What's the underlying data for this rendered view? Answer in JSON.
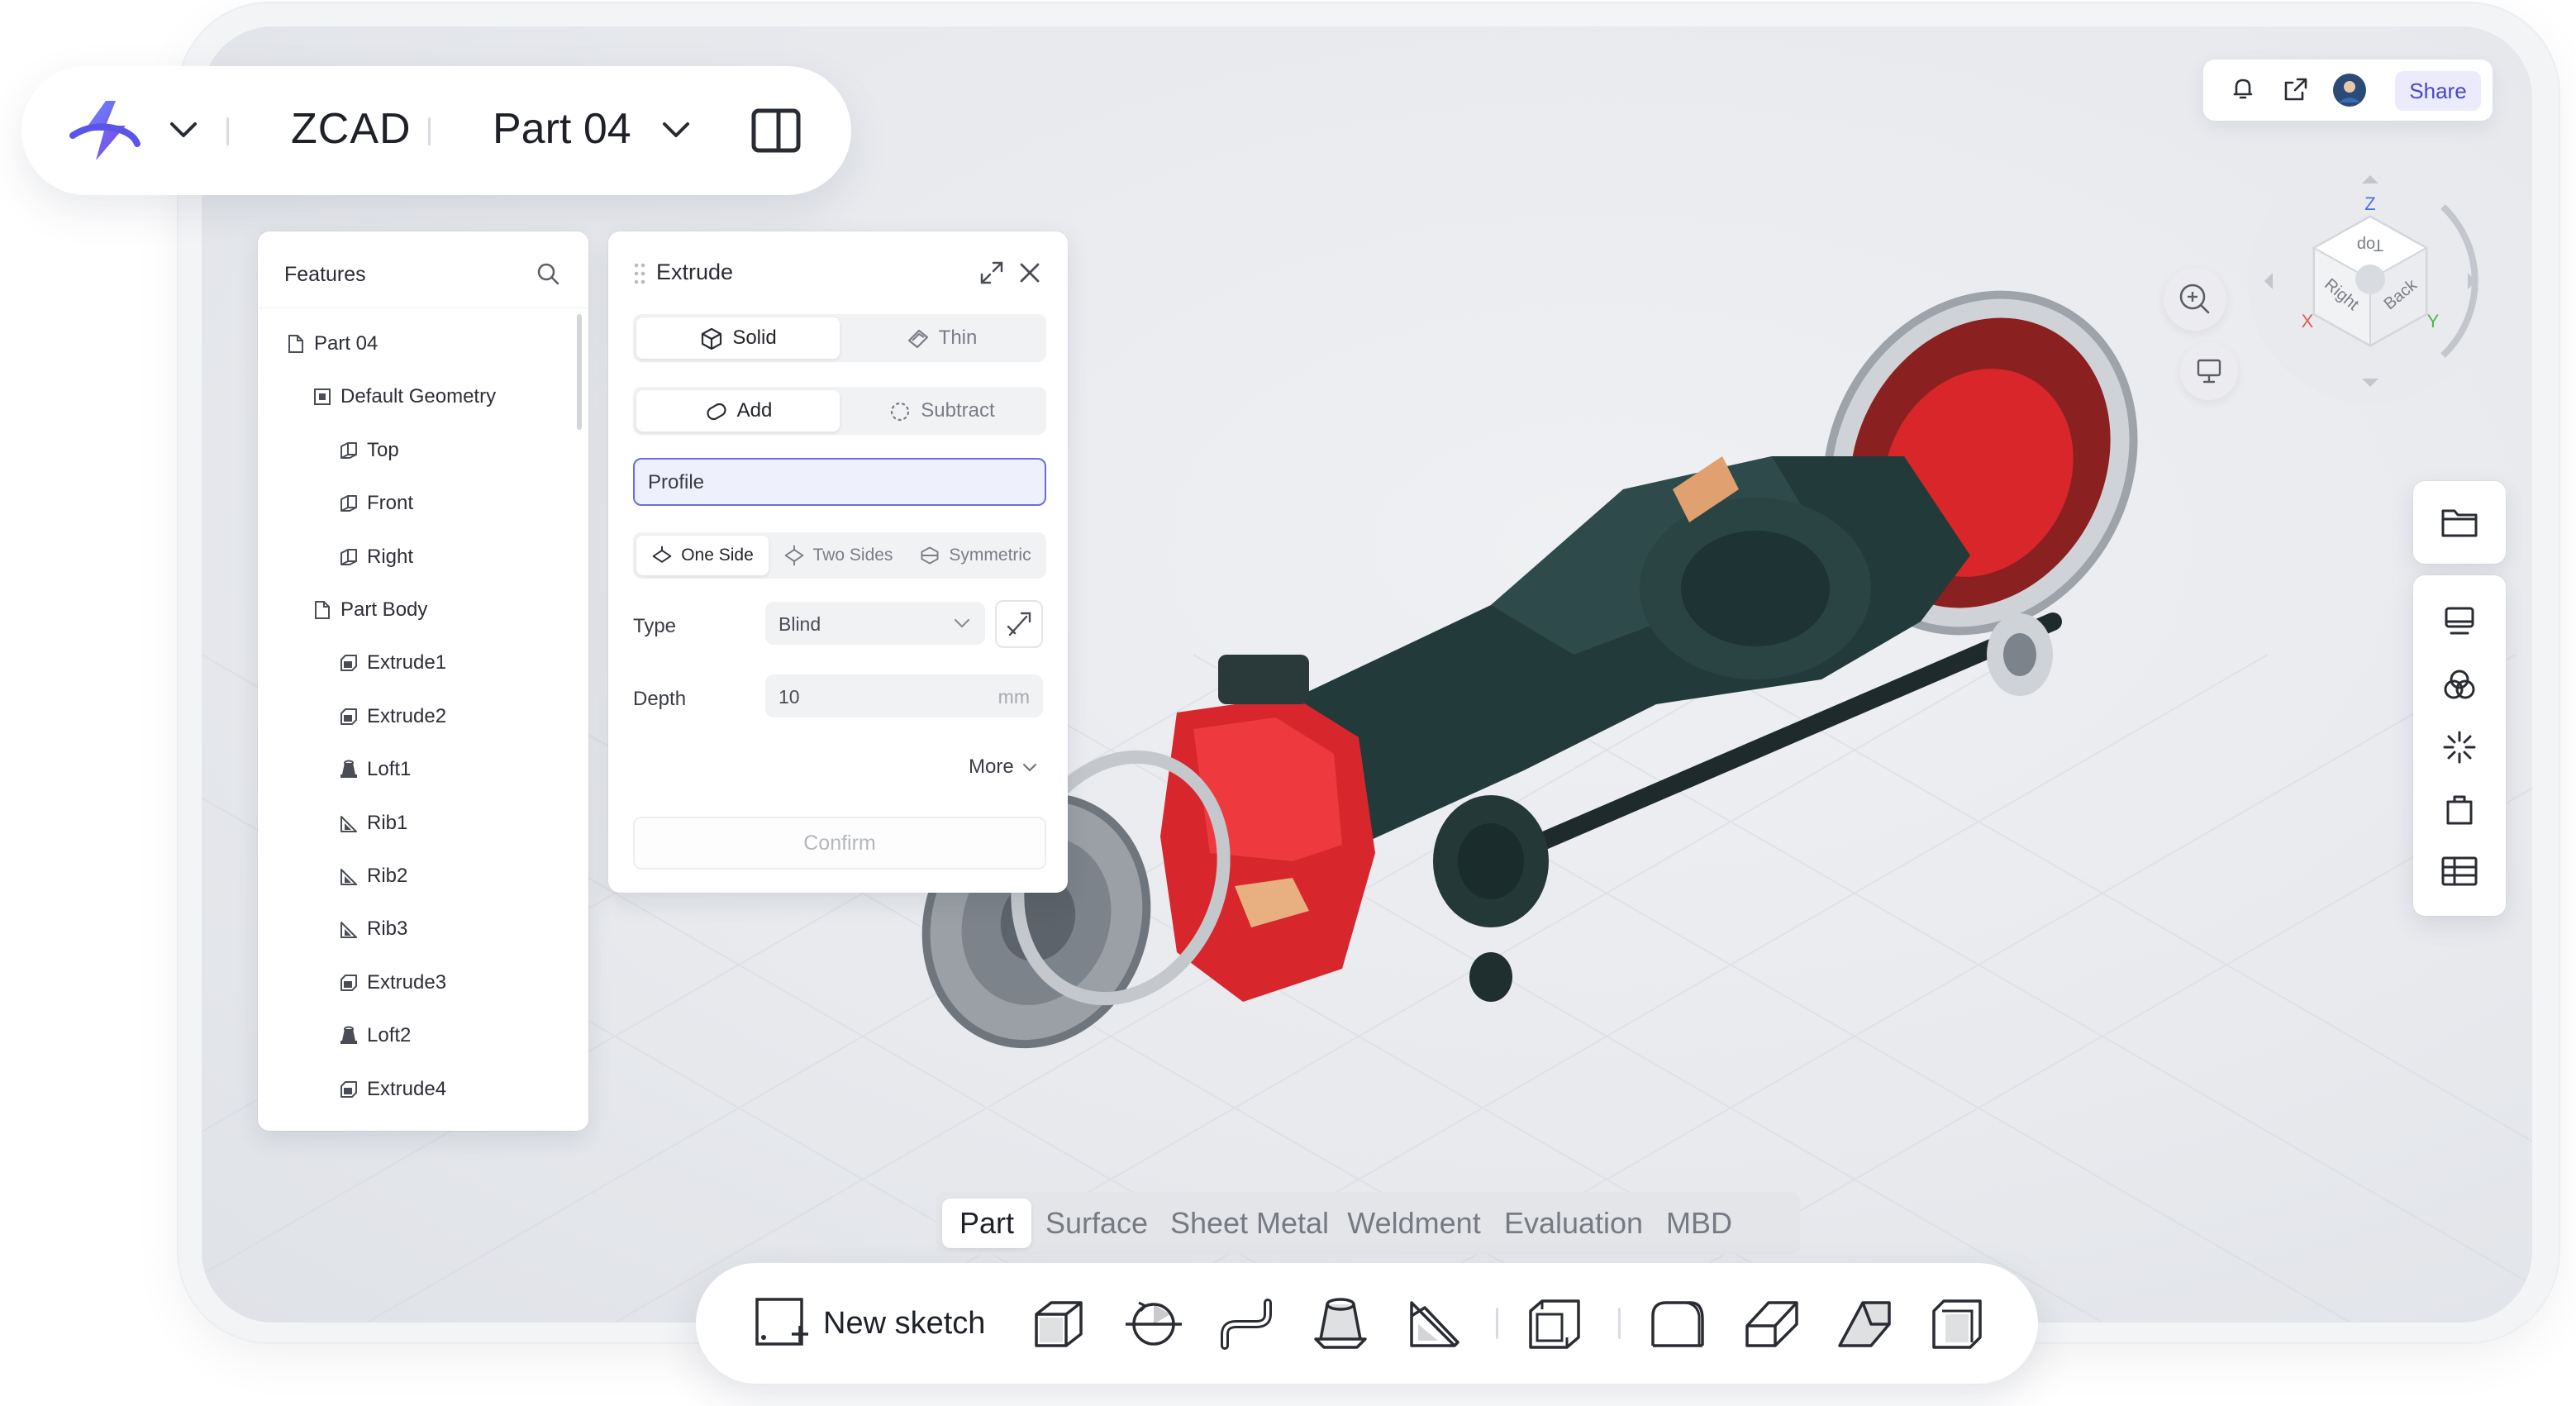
{
  "app": {
    "brand": "ZCAD",
    "document": "Part 04",
    "accent": "#5b4fe0"
  },
  "features_panel": {
    "title": "Features",
    "items": [
      {
        "label": "Part 04",
        "icon": "part-icon",
        "level": 0
      },
      {
        "label": "Default Geometry",
        "icon": "geometry-icon",
        "level": 1
      },
      {
        "label": "Top",
        "icon": "plane-icon",
        "level": 2
      },
      {
        "label": "Front",
        "icon": "plane-icon",
        "level": 2
      },
      {
        "label": "Right",
        "icon": "plane-icon",
        "level": 2
      },
      {
        "label": "Part Body",
        "icon": "body-icon",
        "level": 1
      },
      {
        "label": "Extrude1",
        "icon": "extrude-icon",
        "level": 2
      },
      {
        "label": "Extrude2",
        "icon": "extrude-icon",
        "level": 2
      },
      {
        "label": "Loft1",
        "icon": "loft-icon",
        "level": 2
      },
      {
        "label": "Rib1",
        "icon": "rib-icon",
        "level": 2
      },
      {
        "label": "Rib2",
        "icon": "rib-icon",
        "level": 2
      },
      {
        "label": "Rib3",
        "icon": "rib-icon",
        "level": 2
      },
      {
        "label": "Extrude3",
        "icon": "extrude-icon",
        "level": 2
      },
      {
        "label": "Loft2",
        "icon": "loft-icon",
        "level": 2
      },
      {
        "label": "Extrude4",
        "icon": "extrude-icon",
        "level": 2
      }
    ]
  },
  "extrude_panel": {
    "title": "Extrude",
    "mode": {
      "solid": "Solid",
      "thin": "Thin",
      "selected": "Solid"
    },
    "operation": {
      "add": "Add",
      "subtract": "Subtract",
      "selected": "Add"
    },
    "profile": "Profile",
    "direction": {
      "one_side": "One Side",
      "two_sides": "Two Sides",
      "symmetric": "Symmetric",
      "selected": "One Side"
    },
    "type_label": "Type",
    "type_value": "Blind",
    "depth_label": "Depth",
    "depth_value": "10",
    "depth_unit": "mm",
    "more": "More",
    "confirm": "Confirm"
  },
  "top_right": {
    "share": "Share"
  },
  "view_cube": {
    "faces": [
      "Top",
      "Right",
      "Back"
    ],
    "axes": {
      "z": "Z",
      "x": "X",
      "y": "Y"
    },
    "axis_colors": {
      "x": "#e05a5a",
      "y": "#4bb84b",
      "z": "#4a6ee0"
    }
  },
  "bottom_tabs": {
    "items": [
      "Part",
      "Surface",
      "Sheet Metal",
      "Weldment",
      "Evaluation",
      "MBD"
    ],
    "selected": "Part"
  },
  "bottom_toolbar": {
    "new_sketch": "New sketch",
    "tools": [
      "extrude-tool-icon",
      "revolve-tool-icon",
      "sweep-tool-icon",
      "loft-tool-icon",
      "rib-tool-icon",
      "shell-tool-icon",
      "fillet-tool-icon",
      "chamfer-tool-icon",
      "draft-tool-icon",
      "thicken-tool-icon"
    ]
  }
}
